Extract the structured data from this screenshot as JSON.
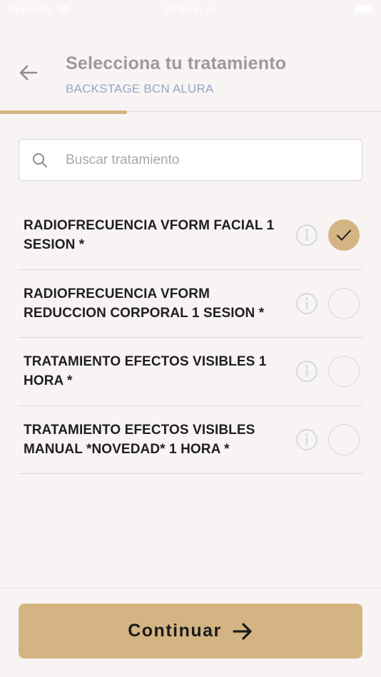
{
  "status_bar": {
    "carrier": "Operador",
    "time": "10:56 a. m."
  },
  "header": {
    "title": "Selecciona tu tratamiento",
    "subtitle": "BACKSTAGE BCN ALURA",
    "progress_fraction": 0.333
  },
  "search": {
    "placeholder": "Buscar tratamiento",
    "value": ""
  },
  "treatments": [
    {
      "name": "RADIOFRECUENCIA VFORM FACIAL 1 SESION *",
      "selected": true
    },
    {
      "name": "RADIOFRECUENCIA VFORM REDUCCION CORPORAL 1 SESION *",
      "selected": false
    },
    {
      "name": "TRATAMIENTO EFECTOS VISIBLES 1 HORA *",
      "selected": false
    },
    {
      "name": "TRATAMIENTO EFECTOS VISIBLES MANUAL *NOVEDAD* 1 HORA *",
      "selected": false
    }
  ],
  "footer": {
    "continue_label": "Continuar"
  },
  "colors": {
    "accent": "#d4b483",
    "subtitle": "#95a6c7",
    "background": "#f8f4f3"
  },
  "icons": {
    "back": "arrow-left-icon",
    "search": "search-icon",
    "info": "info-icon",
    "check": "check-icon",
    "continue": "arrow-right-icon"
  }
}
